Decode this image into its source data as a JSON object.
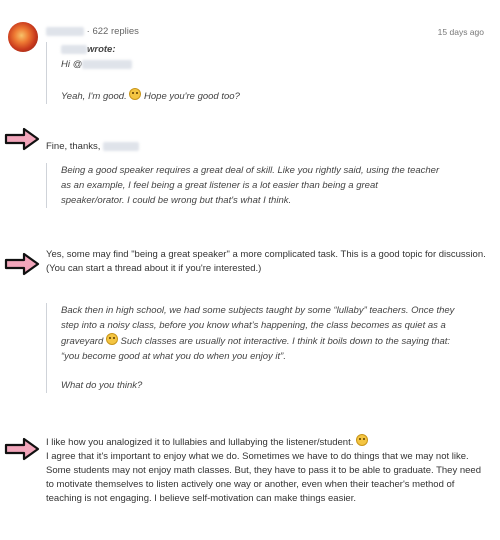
{
  "post": {
    "replies": "622 replies",
    "bullet": "·",
    "time": "15 days ago"
  },
  "quote1": {
    "wrote": "wrote:",
    "hi": "Hi @",
    "line": "Yeah, I'm good.",
    "line_after_emoji": "Hope you're good too?"
  },
  "reply1": {
    "text": "Fine, thanks,"
  },
  "quote2": {
    "text": "Being a good speaker requires a great deal of skill. Like you rightly said, using the teacher as an example, I feel being a great listener is a lot easier than being a great speaker/orator. I could be wrong but that's what I think."
  },
  "reply2": {
    "text": "Yes, some may find \"being a great speaker\" a more complicated task. This is a good topic for discussion. (You can start a thread about it if you're interested.)"
  },
  "quote3": {
    "text_before": "Back then in high school, we had some subjects taught by some “lullaby” teachers. Once they step into a noisy class, before you know what’s happening, the class becomes as quiet as a graveyard",
    "text_after": " Such classes are usually not interactive. I think it boils down to the saying that: “you become good at what you do when you enjoy it”.",
    "question": "What do you think?"
  },
  "reply3": {
    "line1": "I like how you analogized it to lullabies and lullabying the listener/student.",
    "line2": "I agree that it's important to enjoy what we do. Sometimes we have to do things that we may not like. Some students may not enjoy math classes. But, they have to pass it to be able to graduate. They need to motivate themselves to listen actively one way or another, even when their teacher's method of teaching is not engaging. I believe self-motivation can make things easier."
  },
  "colors": {
    "arrow_fill": "#f2a6bb",
    "arrow_stroke": "#111111",
    "quote_border": "#cfd3d9"
  },
  "icons": {
    "arrow": "right-arrow-icon",
    "emoji": "smiley-emoji-icon"
  }
}
